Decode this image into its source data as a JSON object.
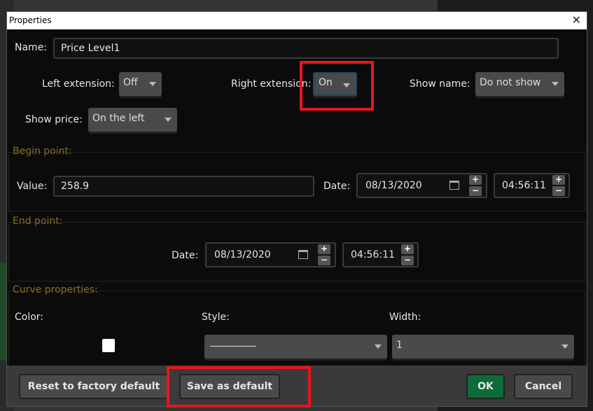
{
  "dialog": {
    "title": "Properties"
  },
  "name": {
    "label": "Name:",
    "value": "Price Level1"
  },
  "left_extension": {
    "label": "Left extension:",
    "value": "Off"
  },
  "right_extension": {
    "label": "Right extension:",
    "value": "On"
  },
  "show_name": {
    "label": "Show name:",
    "value": "Do not show"
  },
  "show_price": {
    "label": "Show price:",
    "value": "On the left"
  },
  "begin_point": {
    "title": "Begin point:",
    "value_label": "Value:",
    "value": "258.9",
    "date_label": "Date:",
    "date": "08/13/2020",
    "time": "04:56:11"
  },
  "end_point": {
    "title": "End point:",
    "date_label": "Date:",
    "date": "08/13/2020",
    "time": "04:56:11"
  },
  "curve": {
    "title": "Curve properties:",
    "color_label": "Color:",
    "style_label": "Style:",
    "width_label": "Width:",
    "width_value": "1",
    "color": "#ffffff"
  },
  "buttons": {
    "reset": "Reset to factory default",
    "save": "Save as default",
    "ok": "OK",
    "cancel": "Cancel"
  },
  "spin": {
    "plus": "+",
    "minus": "−"
  }
}
